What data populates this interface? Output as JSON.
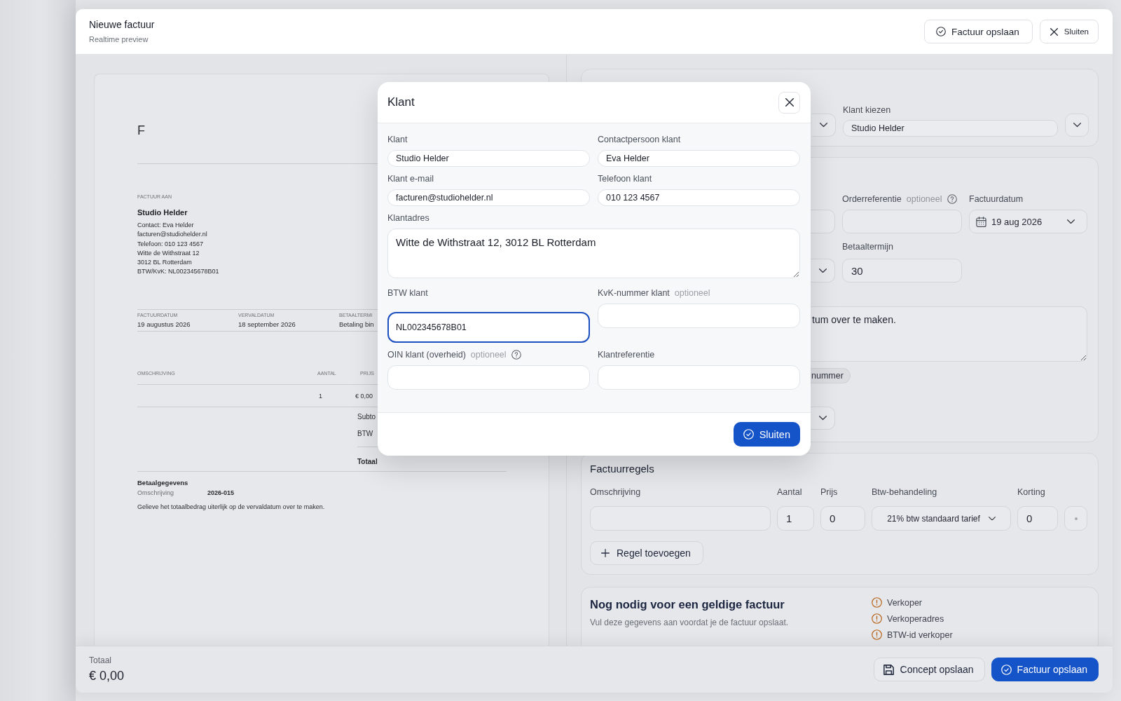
{
  "header": {
    "title": "Nieuwe factuur",
    "subtitle": "Realtime preview",
    "save_button": "Factuur opslaan",
    "close_button": "Sluiten"
  },
  "preview": {
    "logo_letter": "F",
    "bill_to_label": "FACTUUR AAN",
    "client_name": "Studio Helder",
    "client_lines": [
      "Contact: Eva Helder",
      "facturen@studiohelder.nl",
      "Telefoon: 010 123 4567",
      "Witte de Withstraat 12",
      "3012 BL Rotterdam",
      "BTW/KvK: NL002345678B01"
    ],
    "meta": [
      {
        "label": "FACTUURDATUM",
        "value": "19 augustus 2026"
      },
      {
        "label": "VERVALDATUM",
        "value": "18 september 2026"
      },
      {
        "label": "BETAALTERMI",
        "value": "Betaling bin"
      }
    ],
    "columns": [
      "OMSCHRIJVING",
      "AANTAL",
      "PRIJS"
    ],
    "rows": [
      {
        "quantity": "1",
        "price": "€ 0,00"
      }
    ],
    "totals": [
      "Subto",
      "BTW"
    ],
    "total_label": "Totaal",
    "payment": {
      "heading": "Betaalgegevens",
      "label": "Omschrijving",
      "value": "2026-015",
      "note": "Gelieve het totaalbedrag uiterlijk op de vervaldatum over te maken."
    }
  },
  "form": {
    "client_card": {
      "label": "Klant kiezen",
      "value": "Studio Helder"
    },
    "details_card": {
      "order_reference": {
        "label": "Orderreferentie",
        "hint": "optioneel",
        "help": true
      },
      "invoice_date": {
        "label": "Factuurdatum",
        "value": "19 aug 2026"
      },
      "payment_term": {
        "label": "Betaaltermijn",
        "value": "30"
      },
      "textarea_text": "tum over te maken.",
      "chip": "nummer"
    },
    "lines_card": {
      "title": "Factuurregels",
      "columns": [
        "Omschrijving",
        "Aantal",
        "Prijs",
        "Btw-behandeling",
        "Korting"
      ],
      "rows": [
        {
          "quantity": "1",
          "price": "0",
          "vat": "21% btw standaard tarief",
          "discount": "0"
        }
      ],
      "add_button": "Regel toevoegen"
    },
    "requirements_card": {
      "title": "Nog nodig voor een geldige factuur",
      "text": "Vul deze gegevens aan voordat je de factuur opslaat.",
      "items": [
        "Verkoper",
        "Verkoperadres",
        "BTW-id verkoper"
      ]
    }
  },
  "footer": {
    "total_label": "Totaal",
    "total": "€ 0,00",
    "draft_button": "Concept opslaan",
    "save_button": "Factuur opslaan"
  },
  "modal": {
    "title": "Klant",
    "fields": [
      {
        "label": "Klant",
        "kind": "input",
        "value": "Studio Helder",
        "focused": false,
        "help": false
      },
      {
        "label": "Contactpersoon klant",
        "kind": "input",
        "value": "Eva Helder",
        "focused": false,
        "help": false
      },
      {
        "label": "Klant e-mail",
        "kind": "input",
        "value": "facturen@studiohelder.nl",
        "focused": false,
        "help": false
      },
      {
        "label": "Telefoon klant",
        "kind": "input",
        "value": "010 123 4567",
        "focused": false,
        "help": false
      },
      {
        "label": "Klantadres",
        "kind": "textarea",
        "value": "Witte de Withstraat 12, 3012 BL Rotterdam",
        "focused": false,
        "help": false
      },
      {
        "label": "BTW klant",
        "kind": "input",
        "value": "NL002345678B01",
        "focused": true,
        "help": false
      },
      {
        "label": "KvK-nummer klant",
        "kind": "input",
        "hint": "optioneel",
        "focused": false,
        "help": false
      },
      {
        "label": "OIN klant (overheid)",
        "kind": "input",
        "hint": "optioneel",
        "focused": false,
        "help": true
      },
      {
        "label": "Klantreferentie",
        "kind": "input",
        "focused": false,
        "help": false
      }
    ],
    "close_button": "Sluiten"
  }
}
